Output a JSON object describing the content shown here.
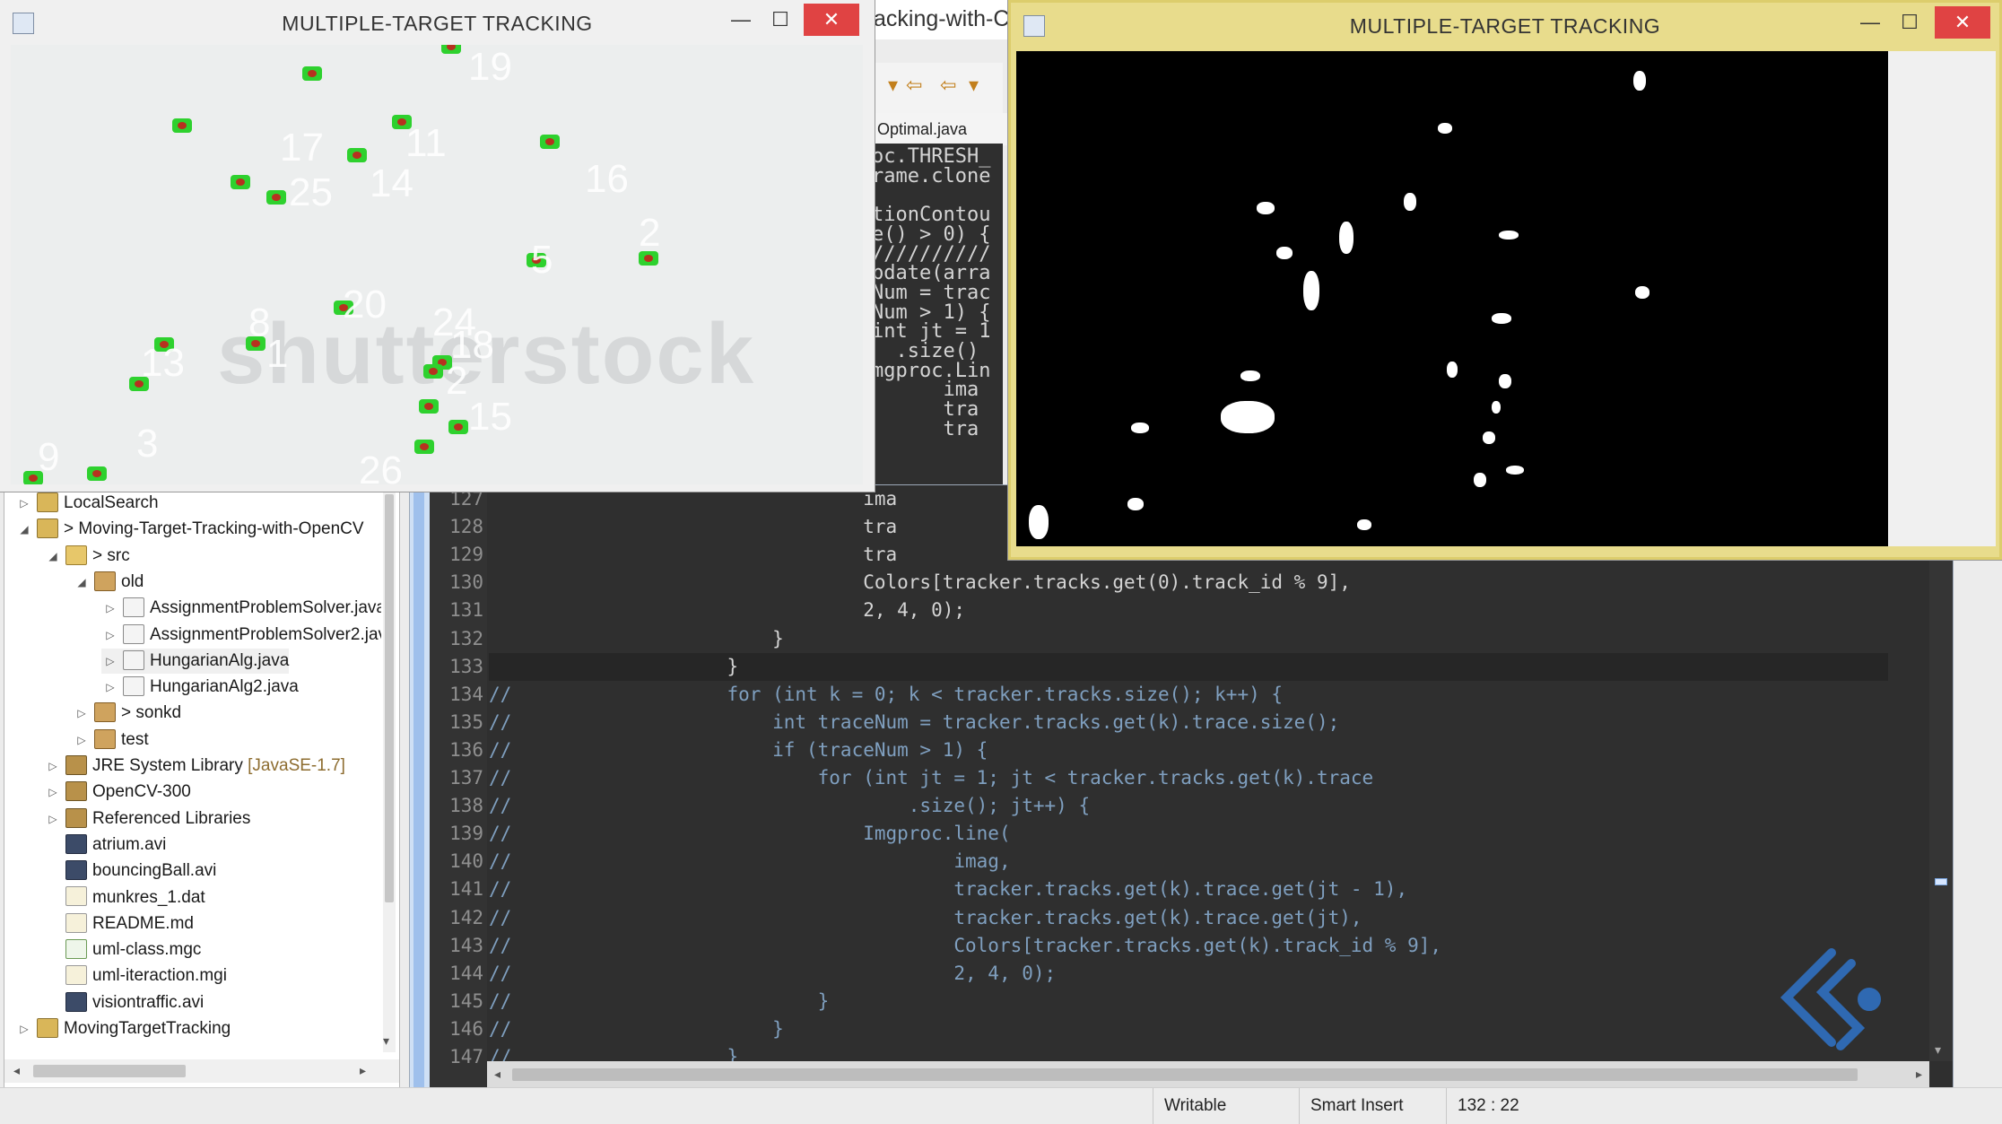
{
  "window_left": {
    "title": "MULTIPLE-TARGET TRACKING",
    "controls": {
      "minimize": "—",
      "maximize": "☐",
      "close": "✕"
    },
    "watermark": "shutterstock",
    "track_ids": [
      "19",
      "17",
      "11",
      "14",
      "16",
      "25",
      "2",
      "5",
      "20",
      "24",
      "8",
      "1",
      "18",
      "13",
      "2",
      "15",
      "3",
      "9",
      "26"
    ]
  },
  "window_right": {
    "title": "MULTIPLE-TARGET TRACKING",
    "controls": {
      "minimize": "—",
      "maximize": "☐",
      "close": "✕"
    }
  },
  "eclipse_behind": {
    "title_fragment": "acking-with-C",
    "tab_fragment": "Optimal.java",
    "code_fragments": [
      "oc.THRESH_",
      "rame.clone",
      "",
      "tionContou",
      "e() > 0) {",
      "//////////",
      "pdate(arra",
      "Num = trac",
      "Num > 1) {",
      "int jt = 1",
      "  .size()",
      "mgproc.Lin",
      "      ima",
      "      tra",
      "      tra"
    ]
  },
  "explorer": {
    "items": [
      {
        "label": "LocalSearch",
        "icon": "project-icon",
        "indent": 0,
        "twisty": "▷"
      },
      {
        "label": "> Moving-Target-Tracking-with-OpenCV",
        "icon": "project-icon",
        "indent": 0,
        "twisty": "◢"
      },
      {
        "label": "> src",
        "icon": "source-folder-icon",
        "indent": 1,
        "twisty": "◢"
      },
      {
        "label": "old",
        "icon": "package-icon",
        "indent": 2,
        "twisty": "◢"
      },
      {
        "label": "AssignmentProblemSolver.java",
        "icon": "java-file-icon",
        "indent": 3,
        "twisty": "▷"
      },
      {
        "label": "AssignmentProblemSolver2.java",
        "icon": "java-file-icon",
        "indent": 3,
        "twisty": "▷"
      },
      {
        "label": "HungarianAlg.java",
        "icon": "java-file-icon",
        "indent": 3,
        "twisty": "▷",
        "selected": true
      },
      {
        "label": "HungarianAlg2.java",
        "icon": "java-file-icon",
        "indent": 3,
        "twisty": "▷"
      },
      {
        "label": "> sonkd",
        "icon": "package-icon",
        "indent": 2,
        "twisty": "▷"
      },
      {
        "label": "test",
        "icon": "package-icon",
        "indent": 2,
        "twisty": "▷"
      },
      {
        "label": "JRE System Library",
        "meta": " [JavaSE-1.7]",
        "icon": "library-icon",
        "indent": 1,
        "twisty": "▷"
      },
      {
        "label": "OpenCV-300",
        "icon": "library-icon",
        "indent": 1,
        "twisty": "▷"
      },
      {
        "label": "Referenced Libraries",
        "icon": "library-icon",
        "indent": 1,
        "twisty": "▷"
      },
      {
        "label": "atrium.avi",
        "icon": "video-file-icon",
        "indent": 1,
        "twisty": ""
      },
      {
        "label": "bouncingBall.avi",
        "icon": "video-file-icon",
        "indent": 1,
        "twisty": ""
      },
      {
        "label": "munkres_1.dat",
        "icon": "data-file-icon",
        "indent": 1,
        "twisty": ""
      },
      {
        "label": "README.md",
        "icon": "text-file-icon",
        "indent": 1,
        "twisty": ""
      },
      {
        "label": "uml-class.mgc",
        "icon": "mgc-file-icon",
        "indent": 1,
        "twisty": ""
      },
      {
        "label": "uml-iteraction.mgi",
        "icon": "mgi-file-icon",
        "indent": 1,
        "twisty": ""
      },
      {
        "label": "visiontraffic.avi",
        "icon": "video-file-icon",
        "indent": 1,
        "twisty": ""
      },
      {
        "label": "MovingTargetTracking",
        "icon": "project-icon",
        "indent": 0,
        "twisty": "▷"
      }
    ]
  },
  "editor": {
    "lines": [
      {
        "n": "127",
        "code": "                                 ima"
      },
      {
        "n": "128",
        "code": "                                 tra"
      },
      {
        "n": "129",
        "code": "                                 tra"
      },
      {
        "n": "130",
        "code": "                                 Colors[tracker.tracks.get(0).track_id % 9],"
      },
      {
        "n": "131",
        "code": "                                 2, 4, 0);"
      },
      {
        "n": "132",
        "code": "                         }"
      },
      {
        "n": "133",
        "code": "                     }",
        "cursor": true
      },
      {
        "n": "134",
        "code": "//                   for (int k = 0; k < tracker.tracks.size(); k++) {"
      },
      {
        "n": "135",
        "code": "//                       int traceNum = tracker.tracks.get(k).trace.size();"
      },
      {
        "n": "136",
        "code": "//                       if (traceNum > 1) {"
      },
      {
        "n": "137",
        "code": "//                           for (int jt = 1; jt < tracker.tracks.get(k).trace"
      },
      {
        "n": "138",
        "code": "//                                   .size(); jt++) {"
      },
      {
        "n": "139",
        "code": "//                               Imgproc.line("
      },
      {
        "n": "140",
        "code": "//                                       imag,"
      },
      {
        "n": "141",
        "code": "//                                       tracker.tracks.get(k).trace.get(jt - 1),"
      },
      {
        "n": "142",
        "code": "//                                       tracker.tracks.get(k).trace.get(jt),"
      },
      {
        "n": "143",
        "code": "//                                       Colors[tracker.tracks.get(k).track_id % 9],"
      },
      {
        "n": "144",
        "code": "//                                       2, 4, 0);"
      },
      {
        "n": "145",
        "code": "//                           }"
      },
      {
        "n": "146",
        "code": "//                       }"
      },
      {
        "n": "147",
        "code": "//                   }"
      }
    ]
  },
  "status": {
    "writable": "Writable",
    "insert_mode": "Smart Insert",
    "position": "132 : 22"
  }
}
